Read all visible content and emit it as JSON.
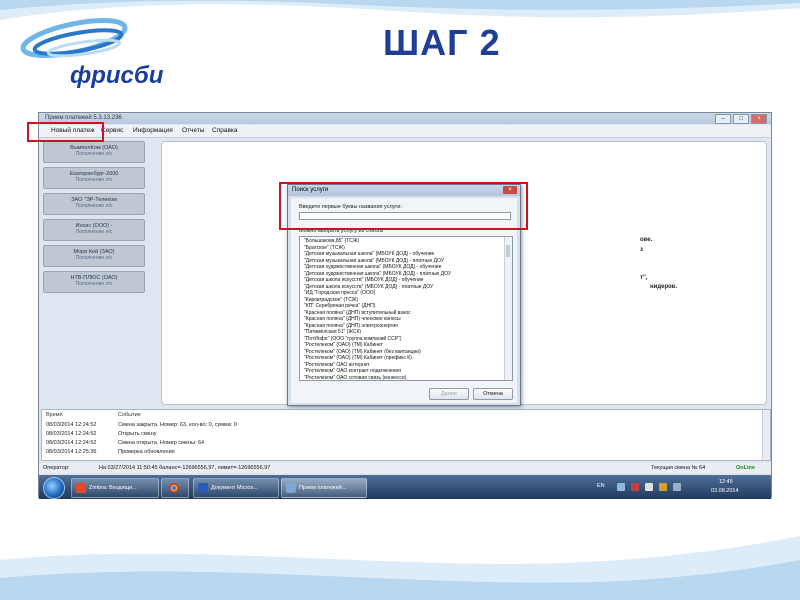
{
  "slide": {
    "title": "ШАГ 2",
    "logo_text": "фрисби",
    "colors": {
      "title": "#1f3e96",
      "highlight": "#d0121e"
    }
  },
  "window": {
    "title": "Прием платежей 5.3.13.236",
    "controls": [
      "–",
      "□",
      "×"
    ],
    "menu": [
      "Новый платеж",
      "Сервис",
      "Информация",
      "Отчеты",
      "Справка"
    ]
  },
  "services": [
    {
      "name": "ВымпелКом (ОАО)",
      "sub": "Пополнение л/с"
    },
    {
      "name": "Екатеринбург-2000",
      "sub": "Пополнение л/с"
    },
    {
      "name": "ЗАО \"ЭР-Телеком",
      "sub": "Пополнение л/с"
    },
    {
      "name": "Инсис (ООО) -",
      "sub": "Пополнение л/с"
    },
    {
      "name": "Мори Кей (ЗАО)",
      "sub": "Пополнение л/с"
    },
    {
      "name": "НТВ-ПЛЮС (ОАО)",
      "sub": "Пополнение л/с"
    }
  ],
  "background_text": [
    "ове.",
    "з",
    "т\",",
    "нидеров."
  ],
  "log": {
    "headers": {
      "time": "Время",
      "event": "Событие"
    },
    "rows": [
      {
        "time": "08/03/2014 12:24:52",
        "event": "Смена закрыта. Номер: 63, кол-во: 0, сумма: 0"
      },
      {
        "time": "08/03/2014 12:24:52",
        "event": "Открыть смену"
      },
      {
        "time": "08/03/2014 12:24:52",
        "event": "Смена открыта. Номер смены: 64"
      },
      {
        "time": "08/03/2014 12:25:36",
        "event": "Проверка обновления"
      }
    ]
  },
  "status": {
    "operator_label": "Оператор:",
    "balance": "На 03/27/2014 11:50:45 баланс=-12696556,97, лимит=-12696556,97",
    "shift": "Текущая смена № 64",
    "online": "OnLine"
  },
  "taskbar": {
    "items": [
      {
        "label": "Zimbra: Входящи...",
        "icon": "zimbra-icon"
      },
      {
        "label": "",
        "icon": "chrome-icon"
      },
      {
        "label": "Документ Micros...",
        "icon": "word-icon"
      },
      {
        "label": "Прием платежей...",
        "icon": "payment-app-icon"
      }
    ],
    "lang": "EN",
    "time": "12:45",
    "date": "03.08.2014"
  },
  "dialog": {
    "title": "Поиск услуги",
    "prompt": "Введите первые буквы названия услуги:",
    "input_value": "",
    "list_label": "Можно выбрать услугу из списка",
    "items": [
      "\"Большакова,85\" (ТСЖ)",
      "\"Братское\" (ТСЖ)",
      "\"Детская музыкальная школа\" (МБОУК ДОД) - обучение",
      "\"Детская музыкальная школа\" (МБОУК ДОД) - платные ДОУ",
      "\"Детская художественная школа\" (МБОУК ДОД) - обучение",
      "\"Детская художественная школа\" (МБОУК ДОД) - платные ДОУ",
      "\"Детская школа искусств\" (МБОУК ДОД) - обучение",
      "\"Детская школа искусств\" (МБОУК ДОД) - платные ДОУ",
      "\"ИД \"Городская пресса\" (ООО)",
      "\"Кировградское\" (ТСЖ)",
      "\"КП\" Серебряная речка\" (ДНП)",
      "\"Красная поляна\" (ДНП) вступительный взнос",
      "\"Красная поляна\" (ДНП) членские взносы",
      "\"Красная поляна\" (ДНП) электроэнергия",
      "\"Патимёлская 51\" (ЖСК)",
      "\"ПотИнфо\" (ООО \"группа компаний ССР\")",
      "\"Ростелеком\" (ОАО) (ТМ) Кабинет",
      "\"Ростелеком\" (ОАО) (ТМ) Кабинет (без квитанции)",
      "\"Ростелеком\" (ОАО) (ТМ) Кабинет (префикс К)",
      "\"Ростелеком\" ОАО интернет",
      "\"Ростелеком\" ОАО контракт подключения",
      "\"Ростелеком\" ОАО сотовая связь (конкесси)"
    ],
    "buttons": {
      "ok": "Далее",
      "cancel": "Отмена"
    }
  }
}
